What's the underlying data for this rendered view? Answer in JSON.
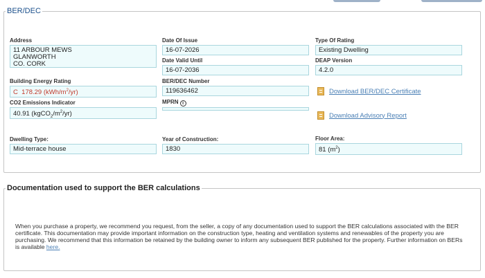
{
  "ber_section": {
    "legend": "BER/DEC",
    "address": {
      "label": "Address",
      "lines": [
        "11 ARBOUR MEWS",
        "GLANWORTH",
        "CO. CORK"
      ]
    },
    "date_of_issue": {
      "label": "Date Of Issue",
      "value": "16-07-2026"
    },
    "date_valid_until": {
      "label": "Date Valid Until",
      "value": "16-07-2036"
    },
    "type_of_rating": {
      "label": "Type Of Rating",
      "value": "Existing Dwelling"
    },
    "deap_version": {
      "label": "DEAP Version",
      "value": "4.2.0"
    },
    "building_energy_rating": {
      "label": "Building Energy Rating",
      "grade": "C",
      "value": "178.29",
      "unit_prefix": "(kWh/m",
      "unit_sup": "2",
      "unit_suffix": "/yr)"
    },
    "ber_number": {
      "label": "BER/DEC Number",
      "value": "119636462"
    },
    "co2": {
      "label": "CO2 Emissions Indicator",
      "value": "40.91",
      "unit_prefix": "(kgCO",
      "unit_sub": "2",
      "unit_mid": "/m",
      "unit_sup": "2",
      "unit_suffix": "/yr)"
    },
    "mprn": {
      "label": "MPRN",
      "value": ""
    },
    "download_certificate": "Download BER/DEC Certificate",
    "download_advisory": "Download Advisory Report",
    "dwelling_type": {
      "label": "Dwelling Type:",
      "value": "Mid-terrace house"
    },
    "year_of_construction": {
      "label": "Year of Construction:",
      "value": "1830"
    },
    "floor_area": {
      "label": "Floor Area:",
      "value": "81",
      "unit_prefix": "(m",
      "unit_sup": "2",
      "unit_suffix": ")"
    }
  },
  "doc_section": {
    "legend": "Documentation used to support the BER calculations",
    "paragraph": "When you purchase a property, we recommend you request, from the seller, a copy of any documentation used to support the BER calculations associated with the BER certificate. This documentation may provide important information on the construction type, heating and ventilation systems and renewables of the property you are purchasing. We recommend that this information be retained by the building owner to inform any subsequent BER published for the property. Further information on BERs is available",
    "link_text": "here."
  },
  "icons": {
    "info": "info-icon",
    "document": "document-icon"
  },
  "colors": {
    "legend_blue": "#1a4f8b",
    "rating_red": "#c0392b",
    "link_blue": "#4a7fb5",
    "field_bg": "#eefbfc",
    "field_border": "#a9d6de"
  }
}
